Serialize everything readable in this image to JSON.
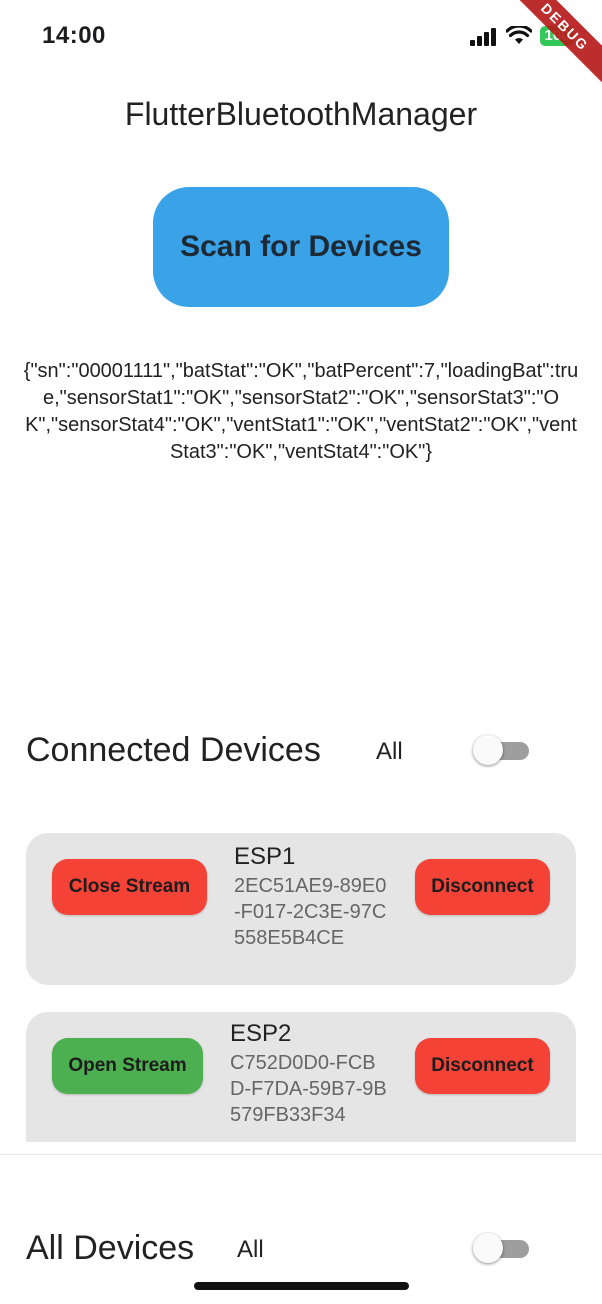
{
  "status": {
    "time": "14:00",
    "battery": "100",
    "debug_label": "DEBUG"
  },
  "app": {
    "title": "FlutterBluetoothManager"
  },
  "scan": {
    "label": "Scan for Devices"
  },
  "received_data": "{\"sn\":\"00001111\",\"batStat\":\"OK\",\"batPercent\":7,\"loadingBat\":true,\"sensorStat1\":\"OK\",\"sensorStat2\":\"OK\",\"sensorStat3\":\"OK\",\"sensorStat4\":\"OK\",\"ventStat1\":\"OK\",\"ventStat2\":\"OK\",\"ventStat3\":\"OK\",\"ventStat4\":\"OK\"}",
  "connected": {
    "title": "Connected Devices",
    "filter_label": "All",
    "toggle_on": false,
    "devices": [
      {
        "name": "ESP1",
        "id": "2EC51AE9-89E0-F017-2C3E-97C558E5B4CE",
        "stream_label": "Close Stream",
        "stream_color": "#f44336",
        "disconnect_label": "Disconnect"
      },
      {
        "name": "ESP2",
        "id": "C752D0D0-FCBD-F7DA-59B7-9B579FB33F34",
        "stream_label": "Open Stream",
        "stream_color": "#4caf50",
        "disconnect_label": "Disconnect"
      }
    ]
  },
  "all_devices": {
    "title": "All Devices",
    "filter_label": "All",
    "toggle_on": false
  },
  "colors": {
    "primary": "#3aa3e8",
    "danger": "#f44336",
    "success": "#4caf50"
  }
}
